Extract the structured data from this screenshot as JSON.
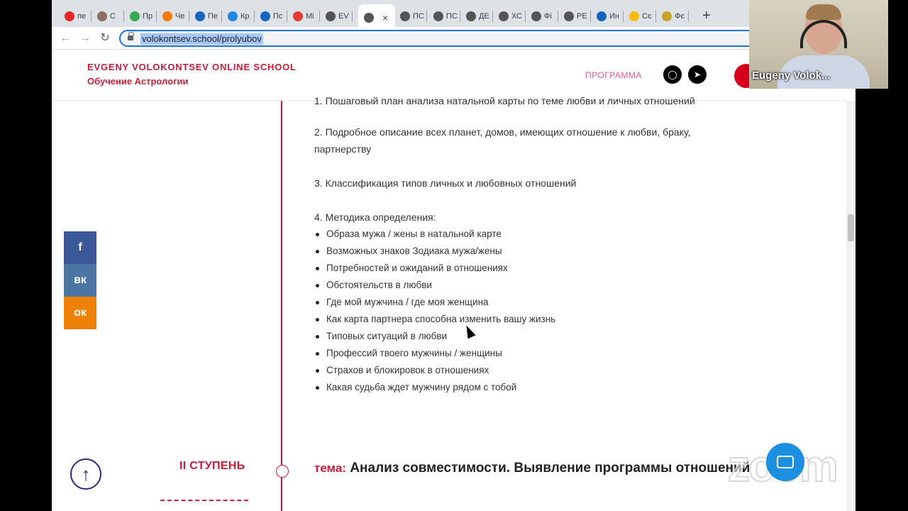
{
  "browser": {
    "tabs": [
      {
        "label": "пе",
        "icon": "yandex-icon",
        "color": "#e62828"
      },
      {
        "label": "С",
        "icon": "shield-icon",
        "color": "#8d6e63"
      },
      {
        "label": "Пр",
        "icon": "windows-icon",
        "color": "#34a853"
      },
      {
        "label": "Че",
        "icon": "ok-icon",
        "color": "#f57c00"
      },
      {
        "label": "Пе",
        "icon": "bank-icon",
        "color": "#1565c0"
      },
      {
        "label": "Кр",
        "icon": "mail-icon",
        "color": "#1e88e5"
      },
      {
        "label": "Пс",
        "icon": "envelope-icon",
        "color": "#1565c0"
      },
      {
        "label": "Mi",
        "icon": "chrome-icon",
        "color": "#e53935"
      },
      {
        "label": "EV",
        "icon": "ev-icon",
        "color": "#555555"
      },
      {
        "label": "",
        "icon": "ev-icon",
        "color": "#555555",
        "active": true
      },
      {
        "label": "ПС",
        "icon": "ev-icon",
        "color": "#555555"
      },
      {
        "label": "ПС",
        "icon": "ev-icon",
        "color": "#555555"
      },
      {
        "label": "ДЕ",
        "icon": "ev-icon",
        "color": "#555555"
      },
      {
        "label": "ХС",
        "icon": "ev-icon",
        "color": "#555555"
      },
      {
        "label": "Фі",
        "icon": "ev-icon",
        "color": "#555555"
      },
      {
        "label": "РЕ",
        "icon": "ev-icon",
        "color": "#555555"
      },
      {
        "label": "Ин",
        "icon": "bank-icon",
        "color": "#1565c0"
      },
      {
        "label": "Сє",
        "icon": "g-icon",
        "color": "#fbbc05"
      },
      {
        "label": "Фє",
        "icon": "eagle-icon",
        "color": "#c9a227"
      }
    ],
    "url": "volokontsev.school/prolyubov"
  },
  "site": {
    "brand_line1": "EVGENY VOLOKONTSEV ONLINE SCHOOL",
    "brand_line2": "Обучение Астрологии",
    "nav_program": "ПРОГРАММА",
    "social": [
      "instagram-icon",
      "telegram-icon"
    ]
  },
  "content": {
    "cut_line": "1. Пошаговый план анализа натальной карты по теме любви и личных отношений",
    "item2": "2. Подробное описание всех планет, домов, имеющих отношение к любви, браку, партнерству",
    "item3": "3. Классификация типов личных и любовных отношений",
    "item4": "4. Методика определения:",
    "bullets": [
      "Образа мужа / жены в натальной карте",
      "Возможных знаков Зодиака мужа/жены",
      "Потребностей и ожиданий в отношениях",
      "Обстоятельств в любви",
      "Где мой мужчина / где моя женщина",
      "Как карта партнера способна изменить вашу жизнь",
      "Типовых ситуаций в любви",
      "Профессий твоего мужчины / женщины",
      "Страхов и блокировок в отношениях",
      "Какая судьба ждет мужчину рядом с тобой"
    ],
    "stage_label": "II СТУПЕНЬ",
    "topic_label": "тема:",
    "topic_text": "Анализ совместимости. Выявление программы отношений"
  },
  "share": [
    {
      "icon": "facebook-icon",
      "glyph": "f",
      "color": "#3b5998"
    },
    {
      "icon": "vk-icon",
      "glyph": "вк",
      "color": "#4c75a3"
    },
    {
      "icon": "odnoklassniki-icon",
      "glyph": "ок",
      "color": "#ee8208"
    }
  ],
  "zoom": {
    "participant_name": "Eugeny Volok...",
    "logo_text": "zoom"
  }
}
